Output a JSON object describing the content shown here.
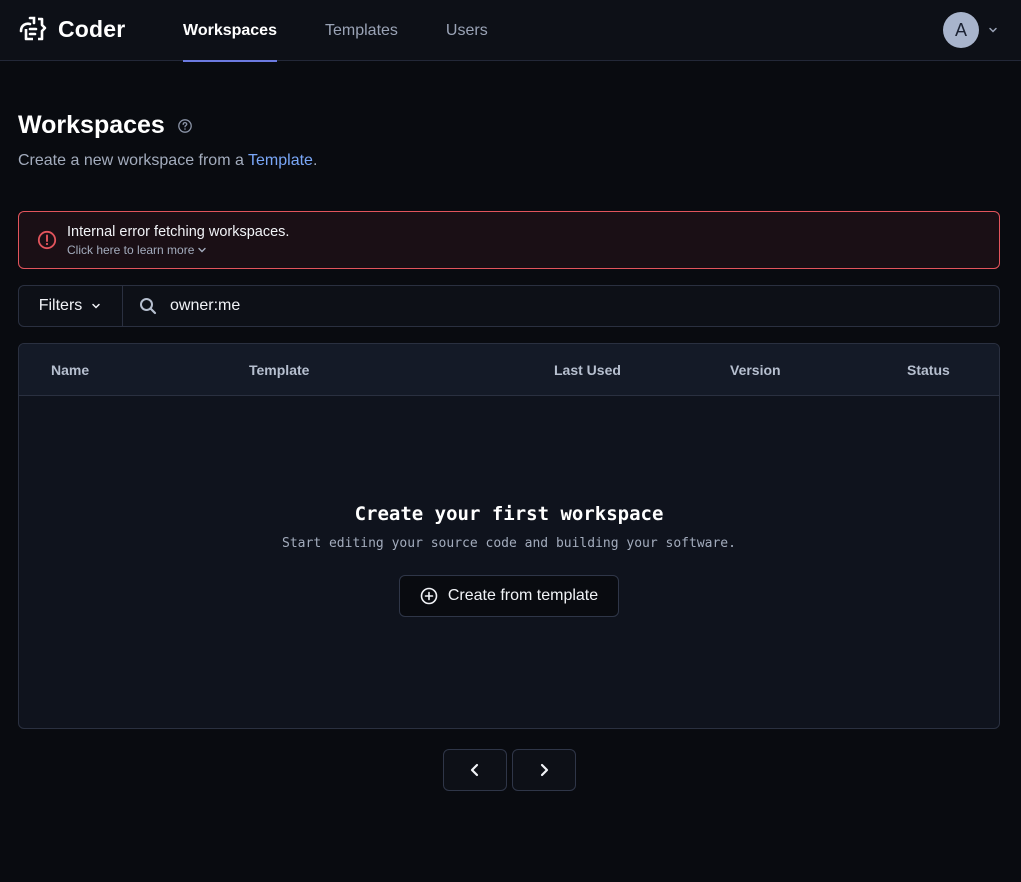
{
  "app": {
    "brand": "Coder"
  },
  "nav": {
    "items": [
      {
        "label": "Workspaces",
        "active": true
      },
      {
        "label": "Templates",
        "active": false
      },
      {
        "label": "Users",
        "active": false
      }
    ]
  },
  "user": {
    "avatar_initial": "A"
  },
  "page": {
    "title": "Workspaces",
    "subtitle_prefix": "Create a new workspace from a ",
    "subtitle_link": "Template",
    "subtitle_suffix": "."
  },
  "alert": {
    "title": "Internal error fetching workspaces.",
    "link": "Click here to learn more"
  },
  "filter": {
    "button_label": "Filters",
    "search_value": "owner:me"
  },
  "table": {
    "columns": [
      "Name",
      "Template",
      "Last Used",
      "Version",
      "Status"
    ],
    "empty_title": "Create your first workspace",
    "empty_subtitle": "Start editing your source code and building your software.",
    "create_button": "Create from template"
  },
  "colors": {
    "accent": "#6c7ae0",
    "link": "#7aa7f7",
    "error": "#e2545c"
  }
}
